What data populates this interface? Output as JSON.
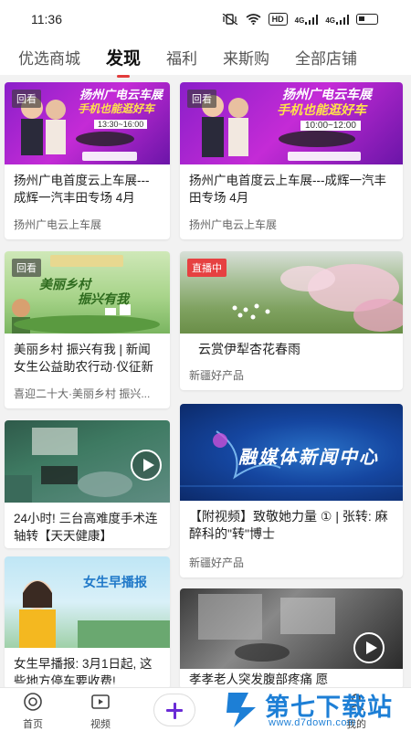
{
  "status_bar": {
    "time": "11:36",
    "icons": [
      "mute-vibrate-icon",
      "wifi-icon",
      "hd-icon",
      "4g-signal-icon",
      "4g-signal-icon",
      "battery-icon"
    ],
    "hd_label": "HD",
    "net1": "4G",
    "net2": "4G"
  },
  "tabs": [
    {
      "label": "优选商城"
    },
    {
      "label": "发现"
    },
    {
      "label": "福利"
    },
    {
      "label": "来斯购"
    },
    {
      "label": "全部店铺"
    }
  ],
  "cards_left": [
    {
      "badge": "回看",
      "title": "扬州广电首度云上车展---成辉一汽丰田专场 4月",
      "source": "扬州广电云上车展",
      "thumb_title": "扬州广电云车展",
      "thumb_sub": "手机也能逛好车",
      "thumb_time": "13:30~16:00"
    },
    {
      "badge": "回看",
      "title": "美丽乡村 振兴有我 | 新闻女生公益助农行动·仪征新",
      "source": "喜迎二十大·美丽乡村 振兴...",
      "thumb_title": "美丽乡村",
      "thumb_sub": "振兴有我"
    },
    {
      "title": "24小时! 三台高难度手术连轴转【天天健康】"
    },
    {
      "title": "女生早播报: 3月1日起, 这些地方停车要收费!",
      "thumb_title": "女生早播报"
    }
  ],
  "cards_right": [
    {
      "badge": "回看",
      "title": "扬州广电首度云上车展---成辉一汽丰田专场 4月",
      "source": "扬州广电云上车展",
      "thumb_title": "扬州广电云车展",
      "thumb_sub": "手机也能逛好车",
      "thumb_time": "10:00~12:00"
    },
    {
      "badge": "直播中",
      "title": "云赏伊犁杏花春雨",
      "source": "新疆好产品"
    },
    {
      "title": "【附视频】致敬她力量 ① | 张转: 麻醉科的\"转\"博士",
      "source": "新疆好产品",
      "thumb_title": "融媒体新闻中心"
    },
    {
      "title": "孝孝老人突发腹部疼痛 愿"
    }
  ],
  "bottom_nav": {
    "home": "首页",
    "video": "视频",
    "mine": "我的"
  },
  "watermark": {
    "main": "第七下载站",
    "sub": "www.d7down.com"
  },
  "colors": {
    "accent": "#e23b3b",
    "publish": "#6a2bd6",
    "live_badge": "#e64141",
    "watermark": "#1d7fd6"
  }
}
